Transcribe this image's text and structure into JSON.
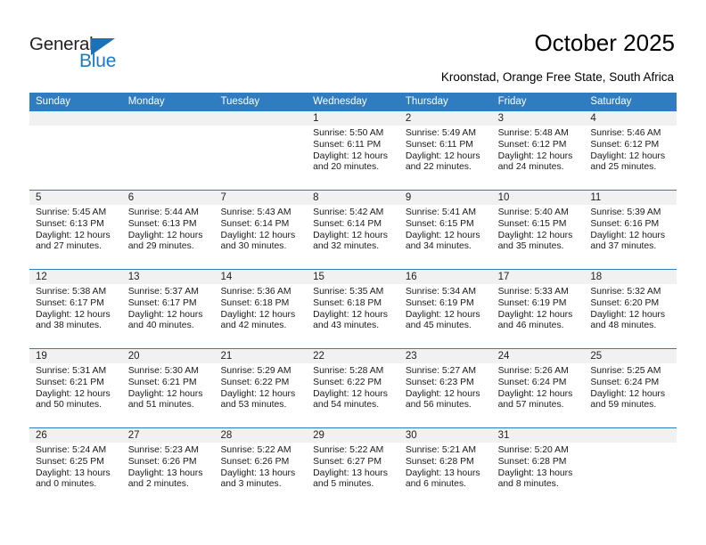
{
  "brand": {
    "line1": "General",
    "line2": "Blue",
    "triangle_icon": "triangle-icon",
    "color_primary": "#1b7ac4",
    "color_text": "#231f20"
  },
  "header": {
    "title": "October 2025",
    "subtitle": "Kroonstad, Orange Free State, South Africa"
  },
  "calendar": {
    "header_bg": "#2f7cc0",
    "daynum_bg": "#f1f1f1",
    "weekdays": [
      "Sunday",
      "Monday",
      "Tuesday",
      "Wednesday",
      "Thursday",
      "Friday",
      "Saturday"
    ],
    "weeks": [
      [
        {
          "day": "",
          "sunrise": "",
          "sunset": "",
          "daylight_line1": "",
          "daylight_line2": "",
          "empty": true
        },
        {
          "day": "",
          "sunrise": "",
          "sunset": "",
          "daylight_line1": "",
          "daylight_line2": "",
          "empty": true
        },
        {
          "day": "",
          "sunrise": "",
          "sunset": "",
          "daylight_line1": "",
          "daylight_line2": "",
          "empty": true
        },
        {
          "day": "1",
          "sunrise": "Sunrise: 5:50 AM",
          "sunset": "Sunset: 6:11 PM",
          "daylight_line1": "Daylight: 12 hours",
          "daylight_line2": "and 20 minutes."
        },
        {
          "day": "2",
          "sunrise": "Sunrise: 5:49 AM",
          "sunset": "Sunset: 6:11 PM",
          "daylight_line1": "Daylight: 12 hours",
          "daylight_line2": "and 22 minutes."
        },
        {
          "day": "3",
          "sunrise": "Sunrise: 5:48 AM",
          "sunset": "Sunset: 6:12 PM",
          "daylight_line1": "Daylight: 12 hours",
          "daylight_line2": "and 24 minutes."
        },
        {
          "day": "4",
          "sunrise": "Sunrise: 5:46 AM",
          "sunset": "Sunset: 6:12 PM",
          "daylight_line1": "Daylight: 12 hours",
          "daylight_line2": "and 25 minutes."
        }
      ],
      [
        {
          "day": "5",
          "sunrise": "Sunrise: 5:45 AM",
          "sunset": "Sunset: 6:13 PM",
          "daylight_line1": "Daylight: 12 hours",
          "daylight_line2": "and 27 minutes."
        },
        {
          "day": "6",
          "sunrise": "Sunrise: 5:44 AM",
          "sunset": "Sunset: 6:13 PM",
          "daylight_line1": "Daylight: 12 hours",
          "daylight_line2": "and 29 minutes."
        },
        {
          "day": "7",
          "sunrise": "Sunrise: 5:43 AM",
          "sunset": "Sunset: 6:14 PM",
          "daylight_line1": "Daylight: 12 hours",
          "daylight_line2": "and 30 minutes."
        },
        {
          "day": "8",
          "sunrise": "Sunrise: 5:42 AM",
          "sunset": "Sunset: 6:14 PM",
          "daylight_line1": "Daylight: 12 hours",
          "daylight_line2": "and 32 minutes."
        },
        {
          "day": "9",
          "sunrise": "Sunrise: 5:41 AM",
          "sunset": "Sunset: 6:15 PM",
          "daylight_line1": "Daylight: 12 hours",
          "daylight_line2": "and 34 minutes."
        },
        {
          "day": "10",
          "sunrise": "Sunrise: 5:40 AM",
          "sunset": "Sunset: 6:15 PM",
          "daylight_line1": "Daylight: 12 hours",
          "daylight_line2": "and 35 minutes."
        },
        {
          "day": "11",
          "sunrise": "Sunrise: 5:39 AM",
          "sunset": "Sunset: 6:16 PM",
          "daylight_line1": "Daylight: 12 hours",
          "daylight_line2": "and 37 minutes."
        }
      ],
      [
        {
          "day": "12",
          "sunrise": "Sunrise: 5:38 AM",
          "sunset": "Sunset: 6:17 PM",
          "daylight_line1": "Daylight: 12 hours",
          "daylight_line2": "and 38 minutes."
        },
        {
          "day": "13",
          "sunrise": "Sunrise: 5:37 AM",
          "sunset": "Sunset: 6:17 PM",
          "daylight_line1": "Daylight: 12 hours",
          "daylight_line2": "and 40 minutes."
        },
        {
          "day": "14",
          "sunrise": "Sunrise: 5:36 AM",
          "sunset": "Sunset: 6:18 PM",
          "daylight_line1": "Daylight: 12 hours",
          "daylight_line2": "and 42 minutes."
        },
        {
          "day": "15",
          "sunrise": "Sunrise: 5:35 AM",
          "sunset": "Sunset: 6:18 PM",
          "daylight_line1": "Daylight: 12 hours",
          "daylight_line2": "and 43 minutes."
        },
        {
          "day": "16",
          "sunrise": "Sunrise: 5:34 AM",
          "sunset": "Sunset: 6:19 PM",
          "daylight_line1": "Daylight: 12 hours",
          "daylight_line2": "and 45 minutes."
        },
        {
          "day": "17",
          "sunrise": "Sunrise: 5:33 AM",
          "sunset": "Sunset: 6:19 PM",
          "daylight_line1": "Daylight: 12 hours",
          "daylight_line2": "and 46 minutes."
        },
        {
          "day": "18",
          "sunrise": "Sunrise: 5:32 AM",
          "sunset": "Sunset: 6:20 PM",
          "daylight_line1": "Daylight: 12 hours",
          "daylight_line2": "and 48 minutes."
        }
      ],
      [
        {
          "day": "19",
          "sunrise": "Sunrise: 5:31 AM",
          "sunset": "Sunset: 6:21 PM",
          "daylight_line1": "Daylight: 12 hours",
          "daylight_line2": "and 50 minutes."
        },
        {
          "day": "20",
          "sunrise": "Sunrise: 5:30 AM",
          "sunset": "Sunset: 6:21 PM",
          "daylight_line1": "Daylight: 12 hours",
          "daylight_line2": "and 51 minutes."
        },
        {
          "day": "21",
          "sunrise": "Sunrise: 5:29 AM",
          "sunset": "Sunset: 6:22 PM",
          "daylight_line1": "Daylight: 12 hours",
          "daylight_line2": "and 53 minutes."
        },
        {
          "day": "22",
          "sunrise": "Sunrise: 5:28 AM",
          "sunset": "Sunset: 6:22 PM",
          "daylight_line1": "Daylight: 12 hours",
          "daylight_line2": "and 54 minutes."
        },
        {
          "day": "23",
          "sunrise": "Sunrise: 5:27 AM",
          "sunset": "Sunset: 6:23 PM",
          "daylight_line1": "Daylight: 12 hours",
          "daylight_line2": "and 56 minutes."
        },
        {
          "day": "24",
          "sunrise": "Sunrise: 5:26 AM",
          "sunset": "Sunset: 6:24 PM",
          "daylight_line1": "Daylight: 12 hours",
          "daylight_line2": "and 57 minutes."
        },
        {
          "day": "25",
          "sunrise": "Sunrise: 5:25 AM",
          "sunset": "Sunset: 6:24 PM",
          "daylight_line1": "Daylight: 12 hours",
          "daylight_line2": "and 59 minutes."
        }
      ],
      [
        {
          "day": "26",
          "sunrise": "Sunrise: 5:24 AM",
          "sunset": "Sunset: 6:25 PM",
          "daylight_line1": "Daylight: 13 hours",
          "daylight_line2": "and 0 minutes."
        },
        {
          "day": "27",
          "sunrise": "Sunrise: 5:23 AM",
          "sunset": "Sunset: 6:26 PM",
          "daylight_line1": "Daylight: 13 hours",
          "daylight_line2": "and 2 minutes."
        },
        {
          "day": "28",
          "sunrise": "Sunrise: 5:22 AM",
          "sunset": "Sunset: 6:26 PM",
          "daylight_line1": "Daylight: 13 hours",
          "daylight_line2": "and 3 minutes."
        },
        {
          "day": "29",
          "sunrise": "Sunrise: 5:22 AM",
          "sunset": "Sunset: 6:27 PM",
          "daylight_line1": "Daylight: 13 hours",
          "daylight_line2": "and 5 minutes."
        },
        {
          "day": "30",
          "sunrise": "Sunrise: 5:21 AM",
          "sunset": "Sunset: 6:28 PM",
          "daylight_line1": "Daylight: 13 hours",
          "daylight_line2": "and 6 minutes."
        },
        {
          "day": "31",
          "sunrise": "Sunrise: 5:20 AM",
          "sunset": "Sunset: 6:28 PM",
          "daylight_line1": "Daylight: 13 hours",
          "daylight_line2": "and 8 minutes."
        },
        {
          "day": "",
          "sunrise": "",
          "sunset": "",
          "daylight_line1": "",
          "daylight_line2": "",
          "empty": true
        }
      ]
    ]
  }
}
